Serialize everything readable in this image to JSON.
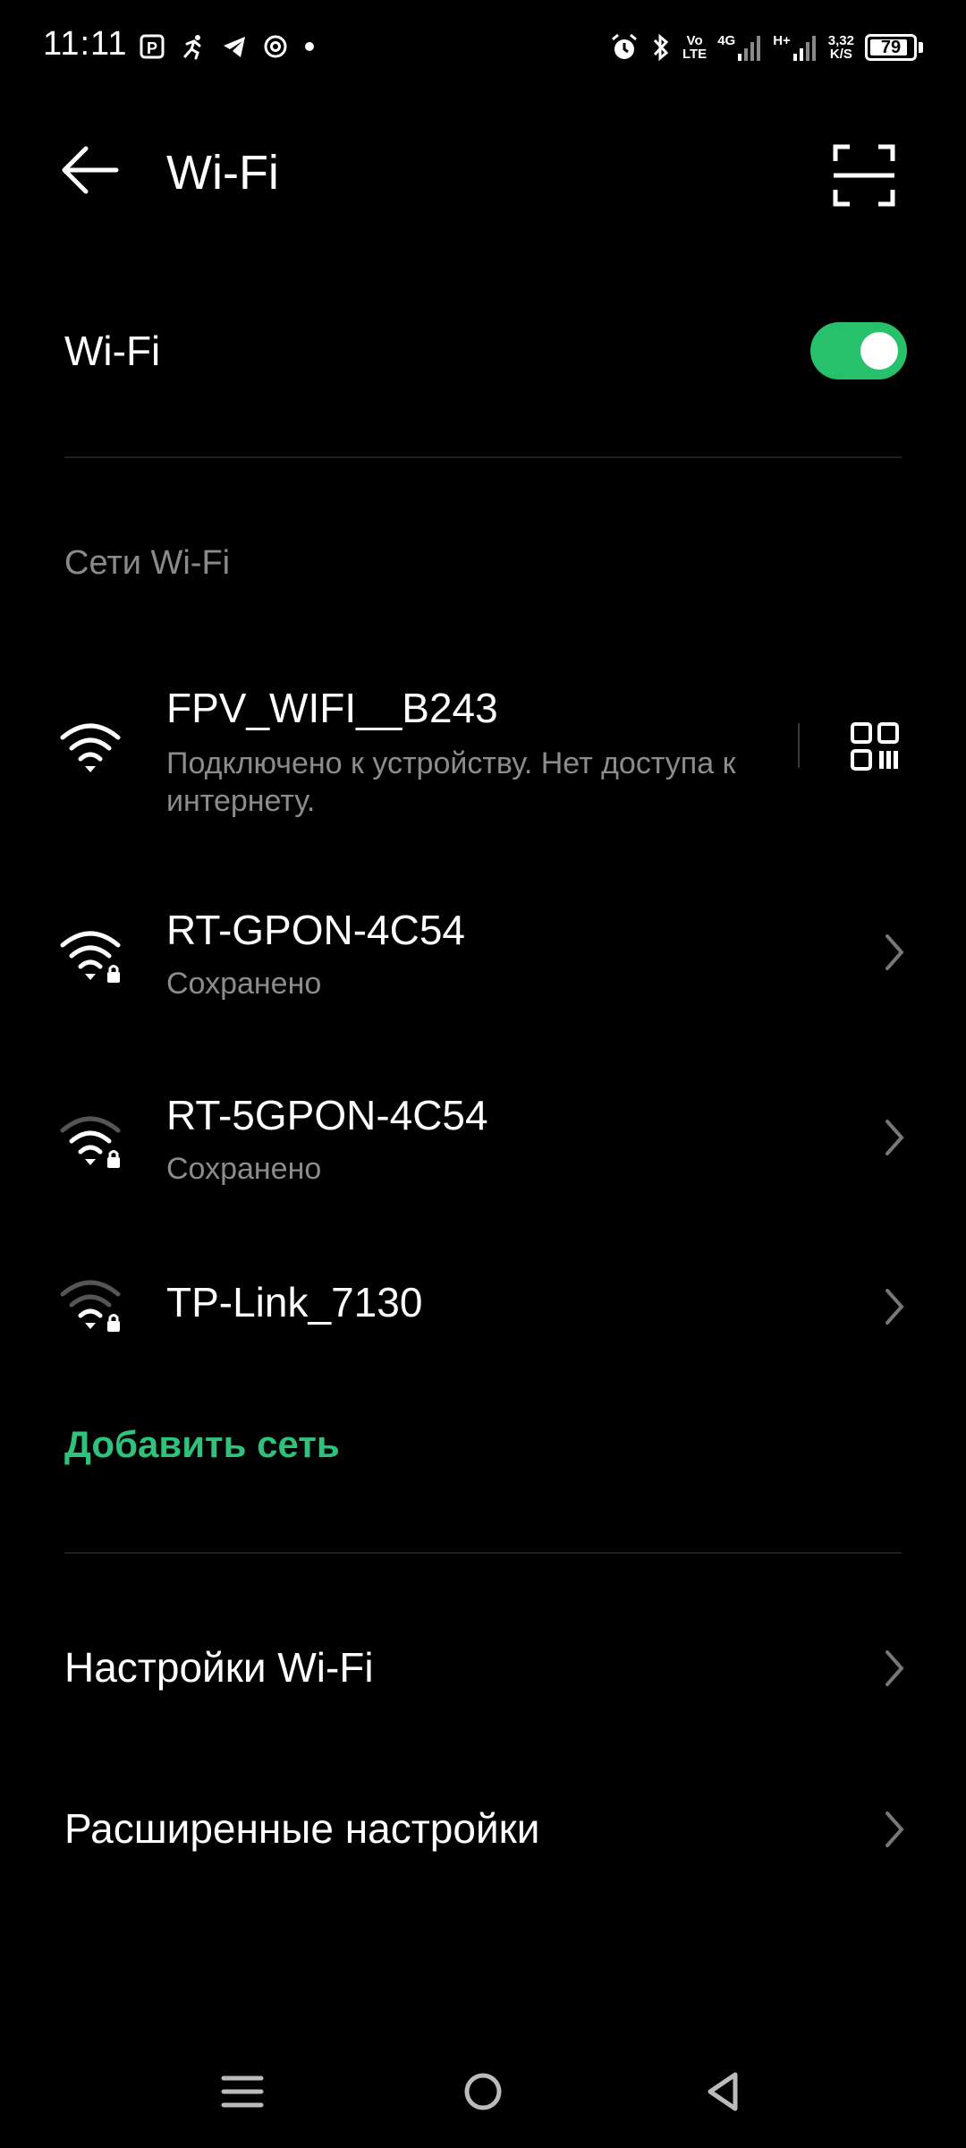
{
  "status": {
    "time": "11:11",
    "volte_top": "Vo",
    "volte_bottom": "LTE",
    "net_4g": "4G",
    "net_h": "H+",
    "speed_top": "3,32",
    "speed_bottom": "K/S",
    "battery": "79"
  },
  "header": {
    "title": "Wi-Fi"
  },
  "wifi_toggle": {
    "label": "Wi-Fi",
    "state": "on",
    "color": "#27c16b"
  },
  "section": {
    "title": "Сети Wi-Fi"
  },
  "networks": [
    {
      "name": "FPV_WIFI__B243",
      "status_line1": "Подключено к устройству. Нет доступа к",
      "status_line2": "интернету.",
      "icon": "wifi-full-icon",
      "action_icon": "qr-code-icon"
    },
    {
      "name": "RT-GPON-4C54",
      "status_line1": "Сохранено",
      "icon": "wifi-locked-icon",
      "action_icon": "chevron-right-icon"
    },
    {
      "name": "RT-5GPON-4C54",
      "status_line1": "Сохранено",
      "icon": "wifi-locked-weak-icon",
      "action_icon": "chevron-right-icon"
    },
    {
      "name": "TP-Link_7130",
      "icon": "wifi-locked-weak-icon",
      "action_icon": "chevron-right-icon"
    }
  ],
  "add_network": {
    "label": "Добавить сеть",
    "color": "#2fc27a"
  },
  "settings": [
    {
      "label": "Настройки Wi-Fi"
    },
    {
      "label": "Расширенные настройки"
    }
  ],
  "navbar": {
    "icons": [
      "menu-icon",
      "home-icon",
      "back-icon"
    ]
  }
}
